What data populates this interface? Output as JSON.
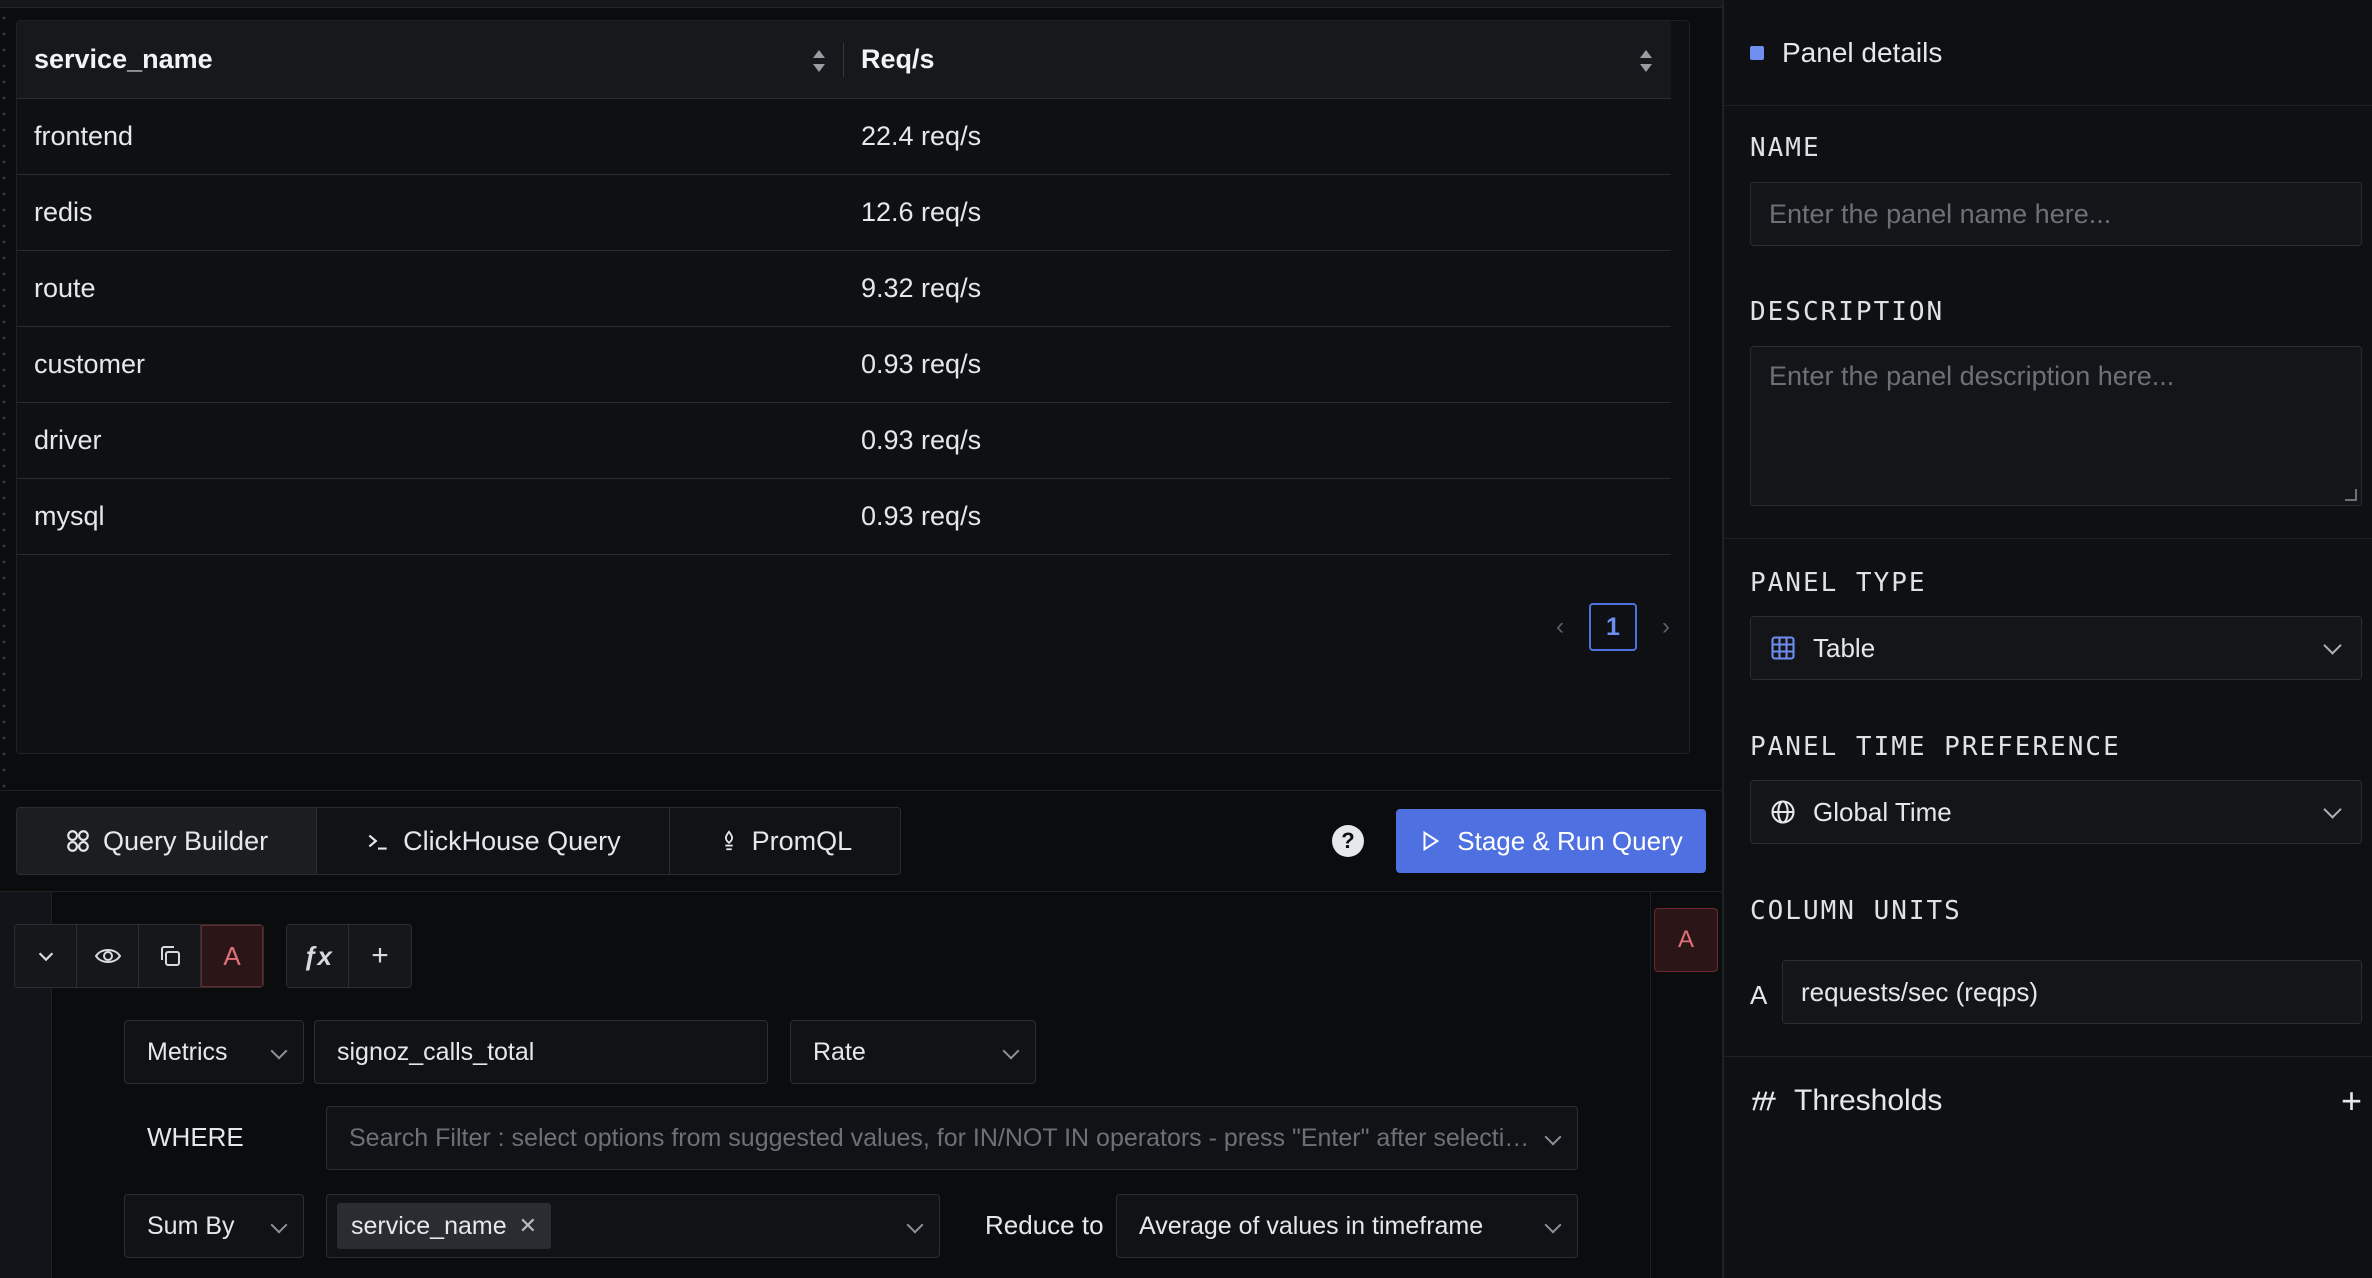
{
  "table": {
    "columns": [
      "service_name",
      "Req/s"
    ],
    "rows": [
      [
        "frontend",
        "22.4 req/s"
      ],
      [
        "redis",
        "12.6 req/s"
      ],
      [
        "route",
        "9.32 req/s"
      ],
      [
        "customer",
        "0.93 req/s"
      ],
      [
        "driver",
        "0.93 req/s"
      ],
      [
        "mysql",
        "0.93 req/s"
      ]
    ],
    "pagination": {
      "prev": "‹",
      "page": "1",
      "next": "›"
    }
  },
  "query_tabs": [
    {
      "label": "Query Builder",
      "icon": "query-builder-icon",
      "active": true
    },
    {
      "label": "ClickHouse Query",
      "icon": "terminal-icon",
      "active": false
    },
    {
      "label": "PromQL",
      "icon": "prometheus-icon",
      "active": false
    }
  ],
  "help_label": "?",
  "run_button": {
    "label": "Stage & Run Query",
    "icon": "play-icon"
  },
  "query": {
    "name": "A",
    "fx_label": "ƒx",
    "add_label": "+",
    "data_source": "Metrics",
    "metric": "signoz_calls_total",
    "aggregate": "Rate",
    "where_label": "WHERE",
    "where_placeholder": "Search Filter : select options from suggested values, for IN/NOT IN operators - press \"Enter\" after selecting options",
    "group_by_op": "Sum By",
    "group_by_tag": "service_name",
    "reduce_label": "Reduce to",
    "reduce_value": "Average of values in timeframe"
  },
  "panel": {
    "header": "Panel details",
    "name_label": "NAME",
    "name_placeholder": "Enter the panel name here...",
    "description_label": "DESCRIPTION",
    "description_placeholder": "Enter the panel description here...",
    "type_label": "PANEL TYPE",
    "type_value": "Table",
    "time_label": "PANEL TIME PREFERENCE",
    "time_value": "Global Time",
    "units_label": "COLUMN UNITS",
    "unit_query": "A",
    "unit_value": "requests/sec (reqps)",
    "thresholds_label": "Thresholds",
    "thresholds_add": "+"
  },
  "colors": {
    "accent": "#4e70e0",
    "query_a": "#e0717a",
    "background": "#0b0c0e"
  }
}
